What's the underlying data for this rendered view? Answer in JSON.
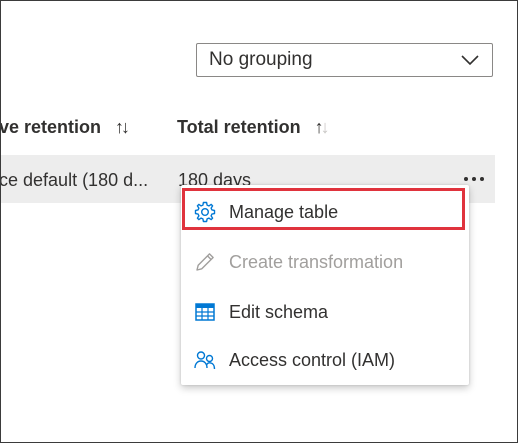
{
  "grouping": {
    "selected": "No grouping"
  },
  "columns": {
    "archive_retention": "ve retention",
    "total_retention": "Total retention"
  },
  "row": {
    "archive_retention": "ace default (180 d...",
    "total_retention": "180 days"
  },
  "context_menu": {
    "items": [
      {
        "label": "Manage table",
        "icon": "gear-icon",
        "enabled": true,
        "highlighted": true
      },
      {
        "label": "Create transformation",
        "icon": "pencil-icon",
        "enabled": false
      },
      {
        "label": "Edit schema",
        "icon": "table-icon",
        "enabled": true
      },
      {
        "label": "Access control (IAM)",
        "icon": "people-icon",
        "enabled": true
      }
    ]
  },
  "colors": {
    "accent": "#0078d4",
    "highlight_border": "#e0333d",
    "row_background": "#ededed",
    "disabled_text": "#a19f9d"
  }
}
